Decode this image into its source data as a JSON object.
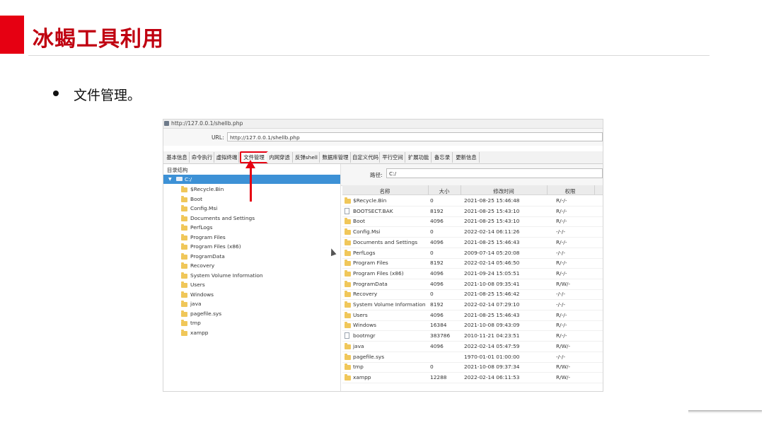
{
  "slide": {
    "title": "冰蝎工具利用",
    "bullet": "文件管理。"
  },
  "window": {
    "title": "http://127.0.0.1/shellb.php",
    "url_label": "URL:",
    "url_value": "http://127.0.0.1/shellb.php"
  },
  "tabs": [
    "基本信息",
    "命令执行",
    "虚拟终端",
    "文件管理",
    "内网穿透",
    "反弹shell",
    "数据库管理",
    "自定义代码",
    "平行空间",
    "扩展功能",
    "备忘录",
    "更新信息"
  ],
  "active_tab": "文件管理",
  "tree": {
    "header": "目录结构",
    "root": "C:/",
    "items": [
      "$Recycle.Bin",
      "Boot",
      "Config.Msi",
      "Documents and Settings",
      "PerfLogs",
      "Program Files",
      "Program Files (x86)",
      "ProgramData",
      "Recovery",
      "System Volume Information",
      "Users",
      "Windows",
      "java",
      "pagefile.sys",
      "tmp",
      "xampp"
    ]
  },
  "path": {
    "label": "路径:",
    "value": "C:/"
  },
  "table": {
    "headers": [
      "名称",
      "大小",
      "修改时间",
      "权限"
    ],
    "rows": [
      {
        "name": "$Recycle.Bin",
        "size": "0",
        "mtime": "2021-08-25 15:46:48",
        "perm": "R/-/-",
        "type": "folder"
      },
      {
        "name": "BOOTSECT.BAK",
        "size": "8192",
        "mtime": "2021-08-25 15:43:10",
        "perm": "R/-/-",
        "type": "file"
      },
      {
        "name": "Boot",
        "size": "4096",
        "mtime": "2021-08-25 15:43:10",
        "perm": "R/-/-",
        "type": "folder"
      },
      {
        "name": "Config.Msi",
        "size": "0",
        "mtime": "2022-02-14 06:11:26",
        "perm": "-/-/-",
        "type": "folder"
      },
      {
        "name": "Documents and Settings",
        "size": "4096",
        "mtime": "2021-08-25 15:46:43",
        "perm": "R/-/-",
        "type": "folder"
      },
      {
        "name": "PerfLogs",
        "size": "0",
        "mtime": "2009-07-14 05:20:08",
        "perm": "-/-/-",
        "type": "folder"
      },
      {
        "name": "Program Files",
        "size": "8192",
        "mtime": "2022-02-14 05:46:50",
        "perm": "R/-/-",
        "type": "folder"
      },
      {
        "name": "Program Files (x86)",
        "size": "4096",
        "mtime": "2021-09-24 15:05:51",
        "perm": "R/-/-",
        "type": "folder"
      },
      {
        "name": "ProgramData",
        "size": "4096",
        "mtime": "2021-10-08 09:35:41",
        "perm": "R/W/-",
        "type": "folder"
      },
      {
        "name": "Recovery",
        "size": "0",
        "mtime": "2021-08-25 15:46:42",
        "perm": "-/-/-",
        "type": "folder"
      },
      {
        "name": "System Volume Information",
        "size": "8192",
        "mtime": "2022-02-14 07:29:10",
        "perm": "-/-/-",
        "type": "folder"
      },
      {
        "name": "Users",
        "size": "4096",
        "mtime": "2021-08-25 15:46:43",
        "perm": "R/-/-",
        "type": "folder"
      },
      {
        "name": "Windows",
        "size": "16384",
        "mtime": "2021-10-08 09:43:09",
        "perm": "R/-/-",
        "type": "folder"
      },
      {
        "name": "bootmgr",
        "size": "383786",
        "mtime": "2010-11-21 04:23:51",
        "perm": "R/-/-",
        "type": "file"
      },
      {
        "name": "java",
        "size": "4096",
        "mtime": "2022-02-14 05:47:59",
        "perm": "R/W/-",
        "type": "folder"
      },
      {
        "name": "pagefile.sys",
        "size": "",
        "mtime": "1970-01-01 01:00:00",
        "perm": "-/-/-",
        "type": "folder"
      },
      {
        "name": "tmp",
        "size": "0",
        "mtime": "2021-10-08 09:37:34",
        "perm": "R/W/-",
        "type": "folder"
      },
      {
        "name": "xampp",
        "size": "12288",
        "mtime": "2022-02-14 06:11:53",
        "perm": "R/W/-",
        "type": "folder"
      }
    ]
  },
  "colors": {
    "accent": "#e60012",
    "tree_selected": "#3d91d6",
    "folder": "#f0c75a"
  }
}
